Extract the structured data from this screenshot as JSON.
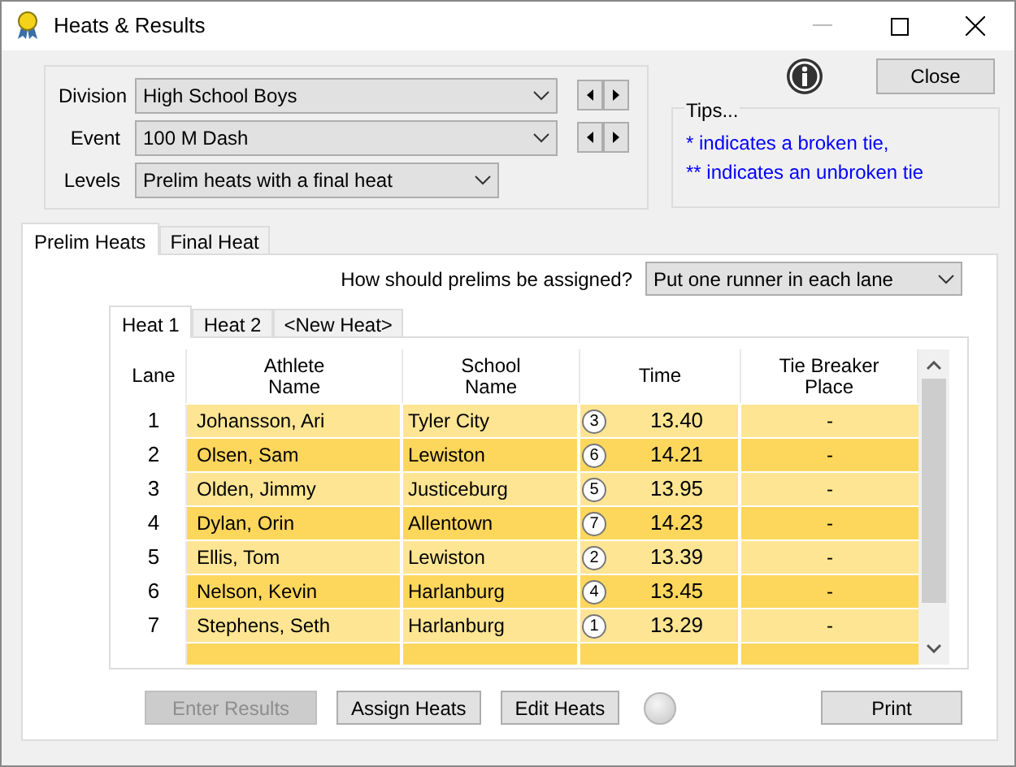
{
  "window": {
    "title": "Heats & Results"
  },
  "filters": [
    {
      "label": "Division",
      "value": "High School Boys",
      "steppers": true
    },
    {
      "label": "Event",
      "value": "100 M Dash",
      "steppers": true
    },
    {
      "label": "Levels",
      "value": "Prelim heats with a final heat",
      "steppers": false
    }
  ],
  "close_button": "Close",
  "tips": {
    "title": "Tips...",
    "lines": [
      "* indicates a broken tie,",
      "** indicates an unbroken tie"
    ]
  },
  "tabs": [
    {
      "label": "Prelim Heats",
      "selected": true
    },
    {
      "label": "Final Heat",
      "selected": false
    }
  ],
  "assignment": {
    "label": "How should prelims be assigned?",
    "value": "Put one runner in each lane"
  },
  "heat_tabs": [
    {
      "label": "Heat 1",
      "selected": true
    },
    {
      "label": "Heat 2",
      "selected": false
    },
    {
      "label": "<New Heat>",
      "selected": false
    }
  ],
  "table": {
    "columns": [
      "Lane",
      "Athlete\nName",
      "School\nName",
      "Time",
      "Tie Breaker\nPlace"
    ],
    "rows": [
      {
        "lane": "1",
        "athlete": "Johansson, Ari",
        "school": "Tyler City",
        "place": "3",
        "time": "13.40",
        "tie_breaker": "-"
      },
      {
        "lane": "2",
        "athlete": "Olsen, Sam",
        "school": "Lewiston",
        "place": "6",
        "time": "14.21",
        "tie_breaker": "-"
      },
      {
        "lane": "3",
        "athlete": "Olden, Jimmy",
        "school": "Justiceburg",
        "place": "5",
        "time": "13.95",
        "tie_breaker": "-"
      },
      {
        "lane": "4",
        "athlete": "Dylan, Orin",
        "school": "Allentown",
        "place": "7",
        "time": "14.23",
        "tie_breaker": "-"
      },
      {
        "lane": "5",
        "athlete": "Ellis, Tom",
        "school": "Lewiston",
        "place": "2",
        "time": "13.39",
        "tie_breaker": "-"
      },
      {
        "lane": "6",
        "athlete": "Nelson, Kevin",
        "school": "Harlanburg",
        "place": "4",
        "time": "13.45",
        "tie_breaker": "-"
      },
      {
        "lane": "7",
        "athlete": "Stephens, Seth",
        "school": "Harlanburg",
        "place": "1",
        "time": "13.29",
        "tie_breaker": "-"
      },
      {}
    ]
  },
  "buttons": [
    {
      "label": "Enter Results",
      "disabled": true
    },
    {
      "label": "Assign Heats",
      "disabled": false
    },
    {
      "label": "Edit Heats",
      "disabled": false
    }
  ],
  "print_button": "Print"
}
